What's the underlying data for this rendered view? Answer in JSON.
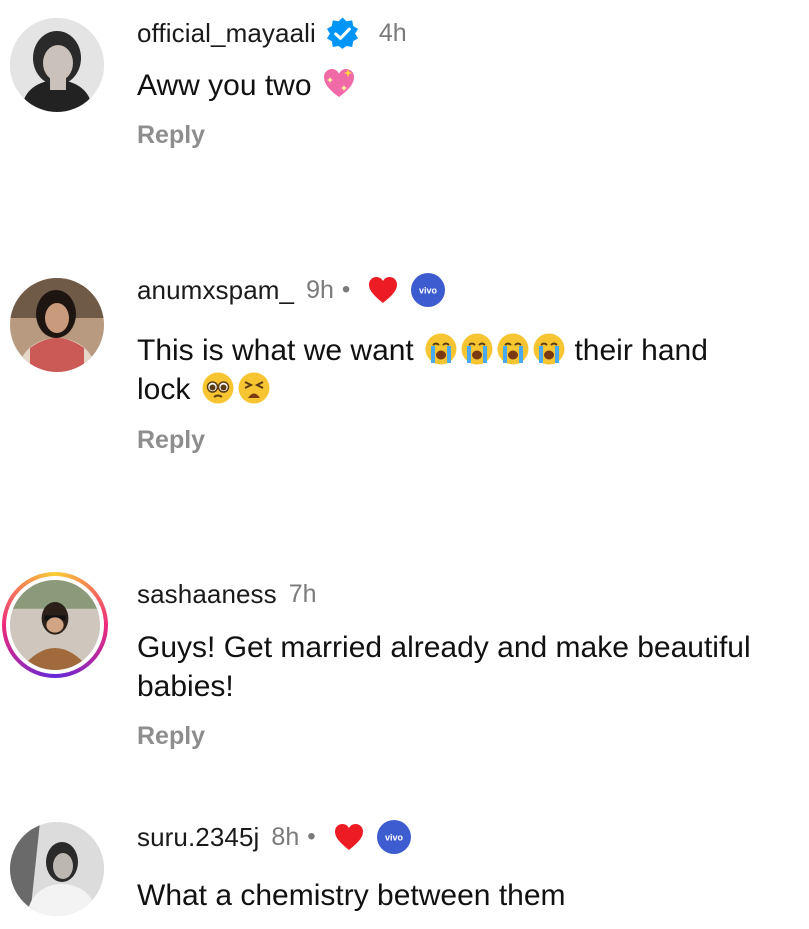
{
  "comments": [
    {
      "username": "official_mayaali",
      "verified_icon": "verified-badge-icon",
      "time": "4h",
      "text": "Aww you two",
      "emojis": [
        "sparkling-heart"
      ],
      "reply_label": "Reply"
    },
    {
      "username": "anumxspam_",
      "time": "9h",
      "dot": "•",
      "liked_icon": "red-heart-icon",
      "brand_icon": "vivo-badge-icon",
      "text_part1": "This is what we want",
      "emojis_mid": [
        "loudly-crying-face",
        "loudly-crying-face",
        "loudly-crying-face",
        "loudly-crying-face"
      ],
      "text_part2": "their hand",
      "text_part3": "lock",
      "emojis_end": [
        "pleading-face",
        "weary-face"
      ],
      "reply_label": "Reply"
    },
    {
      "username": "sashaaness",
      "time": "7h",
      "text": "Guys! Get married already and make beautiful babies!",
      "reply_label": "Reply"
    },
    {
      "username": "suru.2345j",
      "time": "8h",
      "dot": "•",
      "liked_icon": "red-heart-icon",
      "brand_icon": "vivo-badge-icon",
      "text": "What a chemistry between them"
    }
  ],
  "colors": {
    "verified_blue": "#0095f6",
    "heart_red": "#ed1c24",
    "vivo_blue": "#3d5ccf",
    "reply_gray": "#8e8e8e",
    "time_gray": "#7a7a7a"
  }
}
